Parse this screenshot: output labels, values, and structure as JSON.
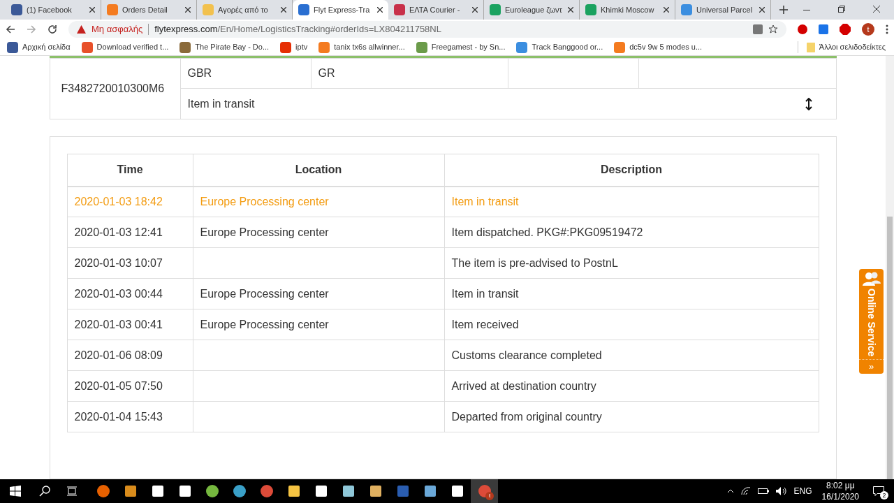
{
  "tabs": [
    {
      "title": "(1) Facebook",
      "selected": false
    },
    {
      "title": "Orders Detail",
      "selected": false
    },
    {
      "title": "Αγορές από το",
      "selected": false
    },
    {
      "title": "Flyt Express-Tra",
      "selected": true
    },
    {
      "title": "ΕΛΤΑ Courier -",
      "selected": false
    },
    {
      "title": "Euroleague ζωντ",
      "selected": false
    },
    {
      "title": "Khimki Moscow",
      "selected": false
    },
    {
      "title": "Universal Parcel",
      "selected": false
    }
  ],
  "address": {
    "security": "Μη ασφαλής",
    "domain": "flytexpress.com",
    "path": "/En/Home/LogisticsTracking#orderIds=LX804211758NL"
  },
  "profile": "t",
  "bookmarks": [
    {
      "title": "Αρχική σελίδα"
    },
    {
      "title": "Download verified t..."
    },
    {
      "title": "The Pirate Bay - Do..."
    },
    {
      "title": "iptv"
    },
    {
      "title": "tanix tx6s allwinner..."
    },
    {
      "title": "Freegamest - by Sn..."
    },
    {
      "title": "Track Banggood or..."
    },
    {
      "title": "dc5v 9w 5 modes u..."
    }
  ],
  "other_bookmarks": "Άλλοι σελιδοδείκτες",
  "summary": {
    "order": "F3482720010300M6",
    "origin": "GBR",
    "destination": "GR",
    "status": "Item in transit"
  },
  "tracking": {
    "columns": [
      "Time",
      "Location",
      "Description"
    ],
    "rows": [
      {
        "time": "2020-01-03 18:42",
        "location": "Europe Processing center",
        "description": "Item in transit",
        "latest": true
      },
      {
        "time": "2020-01-03 12:41",
        "location": "Europe Processing center",
        "description": "Item dispatched. PKG#:PKG09519472",
        "latest": false
      },
      {
        "time": "2020-01-03 10:07",
        "description": "The item is pre-advised to PostnL",
        "latest": false
      },
      {
        "time": "2020-01-03 00:44",
        "location": "Europe Processing center",
        "description": "Item in transit",
        "latest": false
      },
      {
        "time": "2020-01-03 00:41",
        "location": "Europe Processing center",
        "description": "Item received",
        "latest": false
      },
      {
        "time": "2020-01-06 08:09",
        "description": "Customs clearance completed",
        "latest": false
      },
      {
        "time": "2020-01-05 07:50",
        "description": "Arrived at destination country",
        "latest": false
      },
      {
        "time": "2020-01-04 15:43",
        "description": "Departed from original country",
        "latest": false
      }
    ]
  },
  "online_service": {
    "label": "Online Service",
    "arrow": "»"
  },
  "taskbar": {
    "apps": [
      {
        "active": false
      },
      {
        "active": false
      },
      {
        "active": false
      },
      {
        "active": false
      },
      {
        "active": false
      },
      {
        "active": false
      },
      {
        "active": false
      },
      {
        "active": false
      },
      {
        "active": false
      },
      {
        "active": false
      },
      {
        "active": false
      },
      {
        "active": false
      },
      {
        "active": false
      },
      {
        "active": false
      },
      {
        "active": true
      }
    ],
    "chrome_badge": "t",
    "language": "ENG",
    "time": "8:02 μμ",
    "date": "16/1/2020",
    "notifications": "2"
  }
}
